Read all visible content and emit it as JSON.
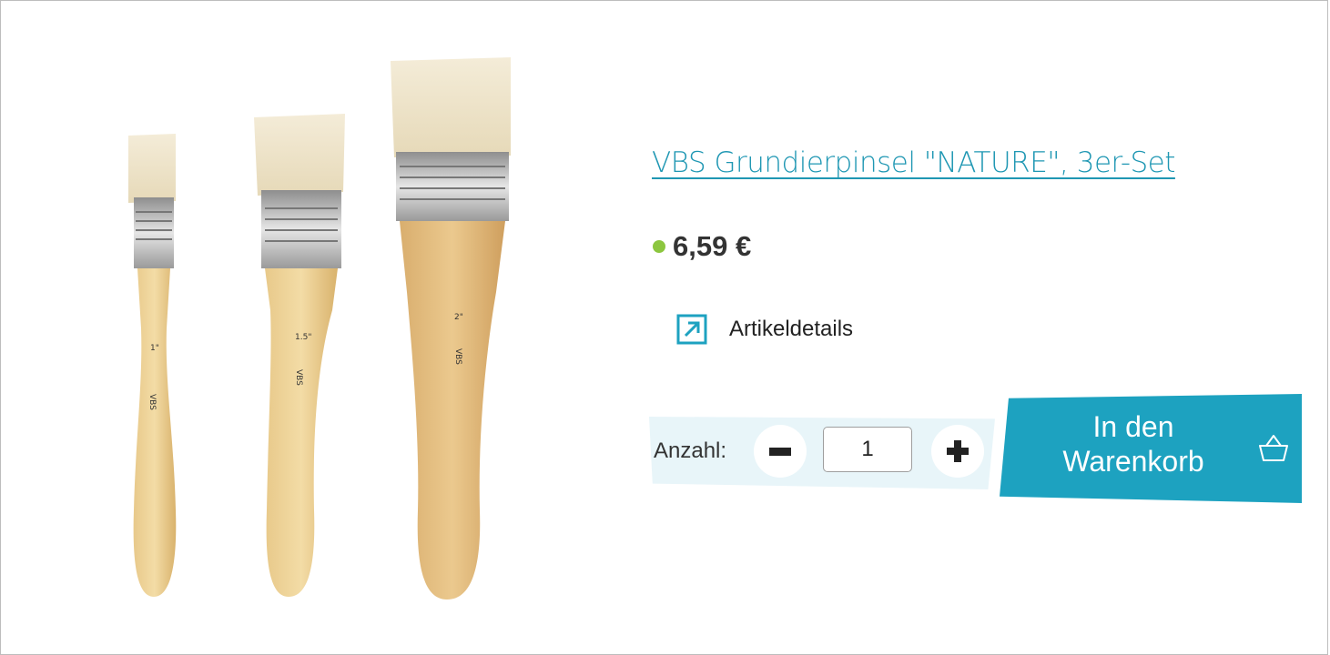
{
  "product": {
    "title": "VBS Grundierpinsel \"NATURE\", 3er-Set",
    "price": "6,59 €",
    "availability_color": "#8cc63f",
    "image_icon": "paint-brushes-image",
    "details_link_label": "Artikeldetails",
    "details_icon": "external-arrow-icon"
  },
  "quantity": {
    "label": "Anzahl:",
    "value": "1",
    "decrement_icon": "minus-icon",
    "increment_icon": "plus-icon"
  },
  "cart": {
    "line1": "In den",
    "line2": "Warenkorb",
    "icon": "basket-icon"
  },
  "colors": {
    "accent": "#1da2c0",
    "link": "#1f97b3",
    "quantity_band": "#e8f5f9"
  }
}
